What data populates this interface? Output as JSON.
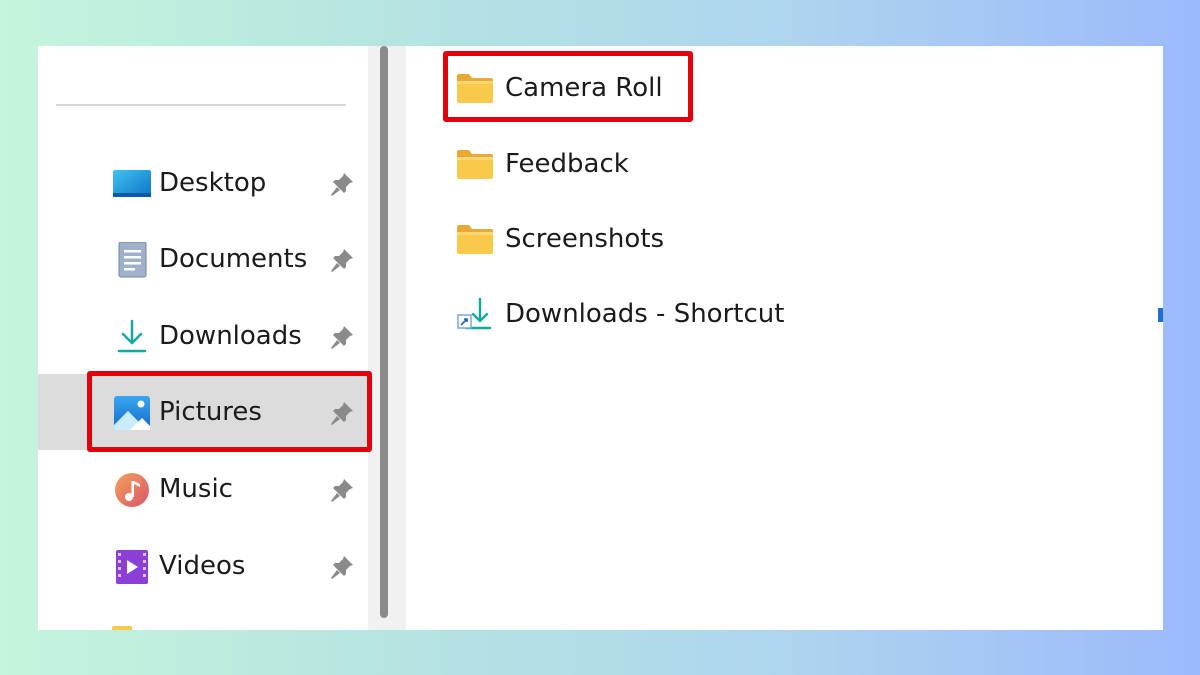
{
  "sidebar": {
    "items": [
      {
        "label": "Desktop",
        "icon": "desktop-icon",
        "pinned": true,
        "selected": false
      },
      {
        "label": "Documents",
        "icon": "documents-icon",
        "pinned": true,
        "selected": false
      },
      {
        "label": "Downloads",
        "icon": "download-icon",
        "pinned": true,
        "selected": false
      },
      {
        "label": "Pictures",
        "icon": "pictures-icon",
        "pinned": true,
        "selected": true
      },
      {
        "label": "Music",
        "icon": "music-icon",
        "pinned": true,
        "selected": false
      },
      {
        "label": "Videos",
        "icon": "videos-icon",
        "pinned": true,
        "selected": false
      }
    ]
  },
  "content": {
    "items": [
      {
        "label": "Camera Roll",
        "icon": "folder-icon"
      },
      {
        "label": "Feedback",
        "icon": "folder-icon"
      },
      {
        "label": "Screenshots",
        "icon": "folder-icon"
      },
      {
        "label": "Downloads - Shortcut",
        "icon": "shortcut-download-icon"
      }
    ]
  },
  "colors": {
    "highlight": "#e3000b",
    "selected_row": "#dcdcdc",
    "folder": "#f8c94a"
  }
}
